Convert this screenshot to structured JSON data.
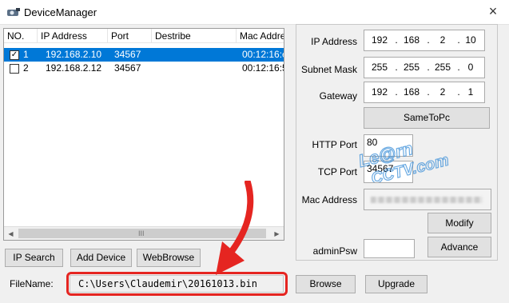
{
  "window": {
    "title": "DeviceManager",
    "close_glyph": "×",
    "icon": "device-manager-icon"
  },
  "device_list": {
    "columns": [
      "NO.",
      "IP Address",
      "Port",
      "Destribe",
      "Mac Addre"
    ],
    "rows": [
      {
        "no": "1",
        "ip": "192.168.2.10",
        "port": "34567",
        "describe": "",
        "mac": "00:12:16:e",
        "checked": true,
        "selected": true
      },
      {
        "no": "2",
        "ip": "192.168.2.12",
        "port": "34567",
        "describe": "",
        "mac": "00:12:16:5",
        "checked": false,
        "selected": false
      }
    ],
    "scroll_grip": "III",
    "scroll_left": "◀",
    "scroll_right": "▶"
  },
  "settings": {
    "ip_label": "IP Address",
    "ip": [
      "192",
      "168",
      "2",
      "10"
    ],
    "mask_label": "Subnet Mask",
    "mask": [
      "255",
      "255",
      "255",
      "0"
    ],
    "gateway_label": "Gateway",
    "gateway": [
      "192",
      "168",
      "2",
      "1"
    ],
    "same_to_pc": "SameToPc",
    "http_label": "HTTP Port",
    "http_value": "80",
    "tcp_label": "TCP Port",
    "tcp_value": "34567",
    "mac_label": "Mac Address",
    "modify": "Modify",
    "admin_label": "adminPsw",
    "advance": "Advance"
  },
  "actions": {
    "ip_search": "IP Search",
    "add_device": "Add Device",
    "web_browse": "WebBrowse"
  },
  "file": {
    "label": "FileName:",
    "path": "C:\\Users\\Claudemir\\20161013.bin",
    "browse": "Browse",
    "upgrade": "Upgrade"
  },
  "watermark": {
    "line1": "Le@rn",
    "line2": "CCTV.com"
  },
  "colors": {
    "selection": "#0078d7",
    "annotation": "#e52521",
    "watermark": "#3b8fd9"
  }
}
